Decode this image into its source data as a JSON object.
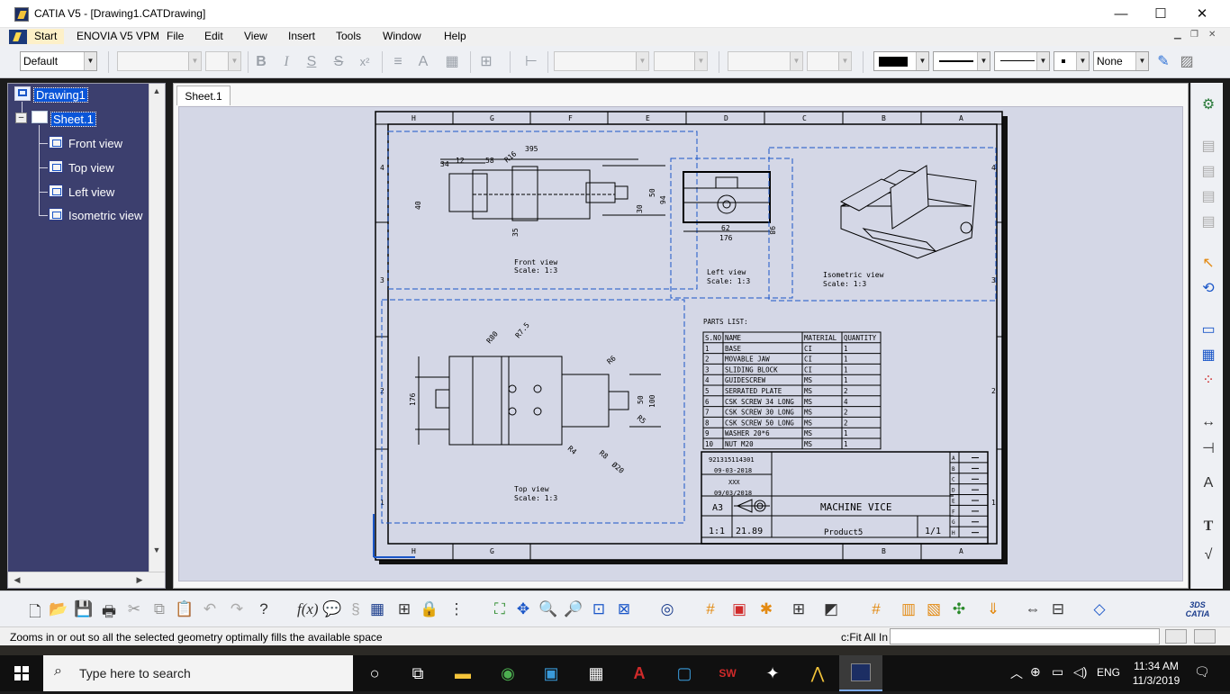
{
  "window": {
    "title": "CATIA V5 - [Drawing1.CATDrawing]",
    "minimize": "—",
    "maximize": "☐",
    "close": "✕"
  },
  "menu": {
    "items": [
      "Start",
      "ENOVIA V5 VPM",
      "File",
      "Edit",
      "View",
      "Insert",
      "Tools",
      "Window",
      "Help"
    ],
    "mdi_min": "▁",
    "mdi_restore": "❐",
    "mdi_close": "✕"
  },
  "toolbar": {
    "style_combo": "Default",
    "font_combo": "",
    "font_size_combo": "",
    "line_color": "#000000",
    "linetype_combo": "None",
    "bold": "B",
    "italic": "I",
    "underline": "S",
    "strike": "S",
    "superscript": "x²"
  },
  "tree": {
    "root": "Drawing1",
    "sheet": "Sheet.1",
    "views": [
      "Front view",
      "Top view",
      "Left view",
      "Isometric view"
    ]
  },
  "sheet_tab": "Sheet.1",
  "drawing": {
    "border_letters_top": [
      "H",
      "G",
      "F",
      "E",
      "D",
      "C",
      "B",
      "A"
    ],
    "border_letters_bottom": [
      "H",
      "G",
      "B",
      "A"
    ],
    "border_numbers_left": [
      "4",
      "3",
      "2",
      "1"
    ],
    "border_numbers_right": [
      "4",
      "3",
      "2",
      "1"
    ],
    "front_view": {
      "label": "Front view",
      "scale": "Scale:  1:3",
      "dims": [
        "395",
        "34",
        "12",
        "58",
        "40",
        "50",
        "94",
        "30",
        "35",
        "R16"
      ]
    },
    "left_view": {
      "label": "Left view",
      "scale": "Scale:  1:3",
      "dims": [
        "62",
        "176",
        "98"
      ]
    },
    "isometric_view": {
      "label": "Isometric view",
      "scale": "Scale:  1:3"
    },
    "top_view": {
      "label": "Top view",
      "scale": "Scale:  1:3",
      "dims": [
        "R80",
        "R7.5",
        "R6",
        "176",
        "50",
        "100",
        "R5",
        "R4",
        "R8",
        "Ø20"
      ]
    },
    "parts_list": {
      "title": "PARTS LIST:",
      "headers": [
        "S.NO",
        "NAME",
        "MATERIAL",
        "QUANTITY"
      ],
      "rows": [
        [
          "1",
          "BASE",
          "CI",
          "1"
        ],
        [
          "2",
          "MOVABLE JAW",
          "CI",
          "1"
        ],
        [
          "3",
          "SLIDING BLOCK",
          "CI",
          "1"
        ],
        [
          "4",
          "GUIDESCREW",
          "MS",
          "1"
        ],
        [
          "5",
          "SERRATED PLATE",
          "MS",
          "2"
        ],
        [
          "6",
          "CSK SCREW 34 LONG",
          "MS",
          "4"
        ],
        [
          "7",
          "CSK SCREW 30 LONG",
          "MS",
          "2"
        ],
        [
          "8",
          "CSK SCREW 50 LONG",
          "MS",
          "2"
        ],
        [
          "9",
          "WASHER 20*6",
          "MS",
          "1"
        ],
        [
          "10",
          "NUT M20",
          "MS",
          "1"
        ]
      ]
    },
    "title_block": {
      "drawn_by": "921315114301",
      "drawn_date": "09-03-2018",
      "checked_by": "XXX",
      "checked_date": "09/03/2018",
      "size": "A3",
      "title": "MACHINE VICE",
      "scale": "1:1",
      "weight": "21.89",
      "product": "Product5",
      "sheet": "1/1",
      "revision_letters": [
        "A",
        "B",
        "C",
        "D",
        "E",
        "F",
        "G",
        "H"
      ]
    }
  },
  "status": {
    "message": "Zooms in or out so all the selected geometry optimally fills the available space",
    "command_label": "c:Fit All In",
    "command_value": ""
  },
  "taskbar": {
    "search_placeholder": "Type here to search",
    "language": "ENG",
    "time": "11:34 AM",
    "date": "11/3/2019"
  },
  "colors": {
    "tree_bg": "#3c3f6e",
    "canvas_bg": "#d4d7e6",
    "selection": "#0a55d8",
    "view_frame": "#1a56c8"
  }
}
